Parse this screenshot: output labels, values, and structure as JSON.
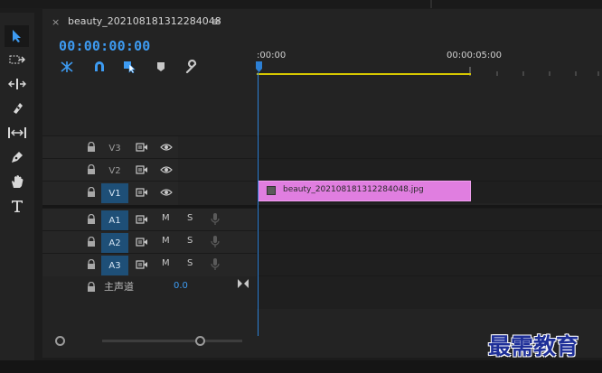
{
  "sequence": {
    "tab_close": "×",
    "title": "beauty_202108181312284048",
    "menu_glyph": "≡",
    "timecode": "00:00:00:00"
  },
  "ruler": {
    "labels": [
      ":00:00",
      "00:00:05:00"
    ]
  },
  "tracks": {
    "video": [
      {
        "name": "V3",
        "targeted": false
      },
      {
        "name": "V2",
        "targeted": false
      },
      {
        "name": "V1",
        "targeted": true
      }
    ],
    "audio": [
      {
        "name": "A1",
        "mute": "M",
        "solo": "S"
      },
      {
        "name": "A2",
        "mute": "M",
        "solo": "S"
      },
      {
        "name": "A3",
        "mute": "M",
        "solo": "S"
      }
    ],
    "master": {
      "label": "主声道",
      "value": "0.0"
    }
  },
  "clip": {
    "name": "beauty_202108181312284048.jpg",
    "color": "#e07ee0"
  },
  "watermark": "最需教育",
  "colors": {
    "accent": "#3d9bf2",
    "work_area": "#d6c700",
    "clip": "#e07ee0",
    "track_target": "#1e4f77"
  },
  "icons": {
    "tools": [
      "selection-icon",
      "track-select-icon",
      "ripple-edit-icon",
      "razor-icon",
      "slip-icon",
      "pen-icon",
      "hand-icon",
      "type-icon"
    ],
    "controls": [
      "nest-sequence-icon",
      "snap-icon",
      "linked-selection-icon",
      "add-marker-icon",
      "timeline-settings-icon"
    ]
  }
}
